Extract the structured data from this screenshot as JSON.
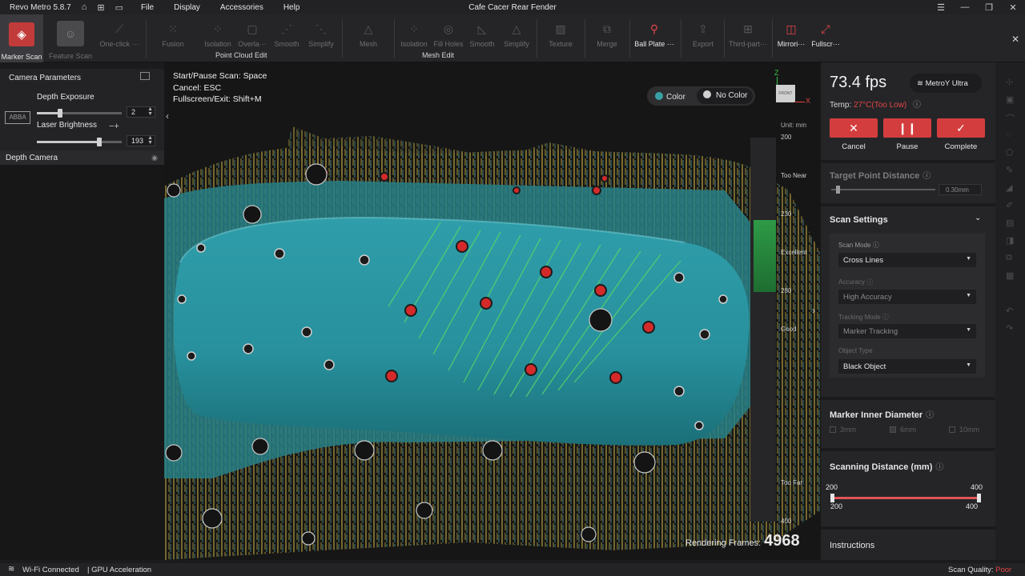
{
  "titlebar": {
    "app_name": "Revo Metro 5.8.7",
    "menu": [
      "File",
      "Display",
      "Accessories",
      "Help"
    ],
    "document_title": "Cafe Cacer Rear Fender"
  },
  "toolbar": {
    "marker_scan": "Marker Scan",
    "feature_scan": "Feature Scan",
    "one_click": "One-click ···",
    "point_cloud_tools": [
      "Fusion",
      "Isolation",
      "Overla···",
      "Smooth",
      "Simplify"
    ],
    "point_cloud_group": "Point Cloud Edit",
    "mesh": "Mesh",
    "mesh_tools": [
      "Isolation",
      "Fill Holes",
      "Smooth",
      "Simplify"
    ],
    "mesh_group": "Mesh Edit",
    "texture": "Texture",
    "merge": "Merge",
    "ball_plate": "Ball Plate ···",
    "export": "Export",
    "third_party": "Third-part···",
    "mirroring": "Mirrori···",
    "fullscreen": "Fullscr···"
  },
  "camera_panel": {
    "title": "Camera Parameters",
    "depth_exposure_label": "Depth Exposure",
    "depth_exposure_value": "2",
    "depth_exposure_level": 0.27,
    "laser_brightness_label": "Laser Brightness",
    "laser_brightness_value": "193",
    "laser_brightness_level": 0.74,
    "thumb_text": "ABBA",
    "depth_camera_label": "Depth Camera"
  },
  "hints": {
    "start_pause": "Start/Pause Scan:",
    "start_pause_key": "Space",
    "cancel": "Cancel:",
    "cancel_key": "ESC",
    "fullscreen": "Fullscreen/Exit:",
    "fullscreen_key": "Shift+M"
  },
  "view_toggle": {
    "color": "Color",
    "no_color": "No Color"
  },
  "axis": {
    "z": "Z",
    "x": "X",
    "cube_label": "FRONT"
  },
  "distance_scale": {
    "unit": "Unit: mm",
    "ticks": [
      "200",
      "230",
      "280",
      "400"
    ],
    "labels": [
      "Too Near",
      "Excellent",
      "Good",
      "Too Far"
    ]
  },
  "rendering": {
    "label": "Rendering Frames:",
    "value": "4968"
  },
  "status_panel": {
    "fps": "73.4 fps",
    "device": "MetroY Ultra",
    "temp_label": "Temp:",
    "temp_value": "27°C(Too Low)",
    "buttons": {
      "cancel": "Cancel",
      "pause": "Pause",
      "complete": "Complete"
    }
  },
  "target_point": {
    "title": "Target Point Distance",
    "value": "0.30mm"
  },
  "scan_settings": {
    "title": "Scan Settings",
    "scan_mode_label": "Scan Mode",
    "scan_mode": "Cross Lines",
    "accuracy_label": "Accuracy",
    "accuracy": "High Accuracy",
    "tracking_label": "Tracking Mode",
    "tracking": "Marker Tracking",
    "object_type_label": "Object Type",
    "object_type": "Black Object"
  },
  "marker_diameter": {
    "title": "Marker Inner Diameter",
    "options": [
      "3mm",
      "6mm",
      "10mm"
    ],
    "selected": "6mm"
  },
  "scan_distance": {
    "title": "Scanning Distance (mm)",
    "min_top": "200",
    "max_top": "400",
    "min_bottom": "200",
    "max_bottom": "400"
  },
  "instructions": "Instructions",
  "statusbar": {
    "wifi": "Wi-Fi Connected",
    "gpu": "| GPU Acceleration",
    "quality_label": "Scan Quality:",
    "quality_value": "Poor"
  },
  "colors": {
    "accent_red": "#d43d3d",
    "mesh_teal": "#2a9aa6",
    "points_yellow": "#c6ad3f",
    "good_green": "#2fae4b"
  }
}
